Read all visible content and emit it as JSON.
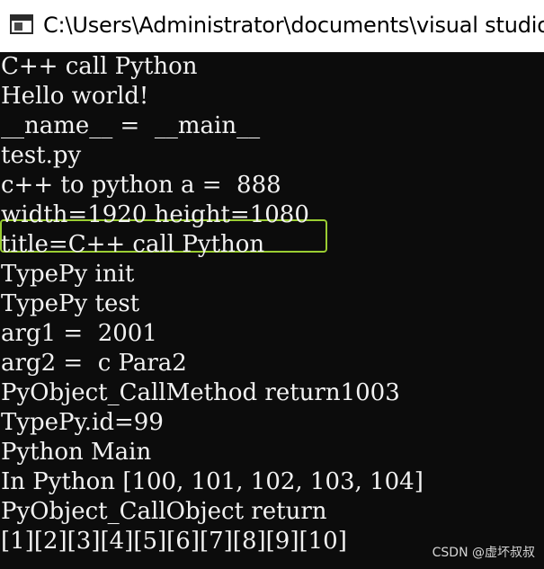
{
  "window": {
    "title": "C:\\Users\\Administrator\\documents\\visual studio",
    "icon": "console-window-icon"
  },
  "console": {
    "lines": [
      "C++ call Python",
      "Hello world!",
      "__name__ =  __main__",
      "test.py",
      "c++ to python a =  888",
      "width=1920 height=1080",
      "title=C++ call Python",
      "TypePy init",
      "TypePy test",
      "arg1 =  2001",
      "arg2 =  c Para2",
      "PyObject_CallMethod return1003",
      "TypePy.id=99",
      "Python Main",
      "In Python [100, 101, 102, 103, 104]",
      "PyObject_CallObject return",
      "[1][2][3][4][5][6][7][8][9][10]"
    ],
    "highlighted_line_index": 4,
    "highlight_color": "#9acd32",
    "text_color": "#f2f2f2",
    "background_color": "#0c0c0c"
  },
  "watermark": {
    "text": "CSDN @虚坏叔叔"
  }
}
